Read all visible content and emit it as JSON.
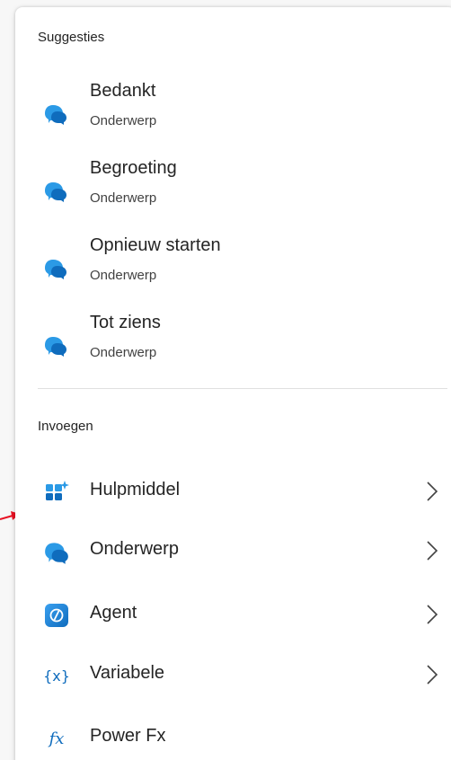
{
  "suggestions": {
    "header": "Suggesties",
    "items": [
      {
        "title": "Bedankt",
        "subtitle": "Onderwerp",
        "icon": "chat-bubbles-icon"
      },
      {
        "title": "Begroeting",
        "subtitle": "Onderwerp",
        "icon": "chat-bubbles-icon"
      },
      {
        "title": "Opnieuw starten",
        "subtitle": "Onderwerp",
        "icon": "chat-bubbles-icon"
      },
      {
        "title": "Tot ziens",
        "subtitle": "Onderwerp",
        "icon": "chat-bubbles-icon"
      }
    ]
  },
  "insert": {
    "header": "Invoegen",
    "items": [
      {
        "label": "Hulpmiddel",
        "icon": "tool-grid-sparkle-icon",
        "has_submenu": true
      },
      {
        "label": "Onderwerp",
        "icon": "chat-bubbles-icon",
        "has_submenu": true
      },
      {
        "label": "Agent",
        "icon": "agent-icon",
        "has_submenu": true
      },
      {
        "label": "Variabele",
        "icon": "variable-braces-icon",
        "has_submenu": true
      },
      {
        "label": "Power Fx",
        "icon": "fx-icon",
        "has_submenu": false
      }
    ]
  },
  "colors": {
    "accent_blue": "#0f6cbd",
    "light_blue": "#2b9ae6",
    "annotation_arrow": "#e81123"
  }
}
